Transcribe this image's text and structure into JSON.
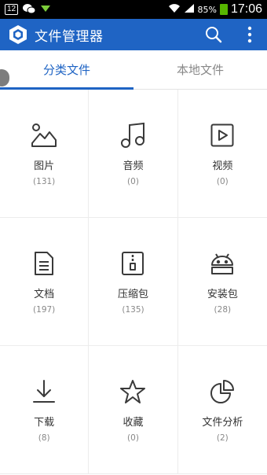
{
  "status_bar": {
    "notification_badge": "12",
    "battery": "85%",
    "time": "17:06"
  },
  "app_bar": {
    "title": "文件管理器"
  },
  "tabs": [
    {
      "label": "分类文件",
      "active": true
    },
    {
      "label": "本地文件",
      "active": false
    }
  ],
  "categories": [
    {
      "label": "图片",
      "count": "(131)",
      "icon": "image-icon"
    },
    {
      "label": "音频",
      "count": "(0)",
      "icon": "music-note-icon"
    },
    {
      "label": "视频",
      "count": "(0)",
      "icon": "video-play-icon"
    },
    {
      "label": "文档",
      "count": "(197)",
      "icon": "document-icon"
    },
    {
      "label": "压缩包",
      "count": "(135)",
      "icon": "archive-icon"
    },
    {
      "label": "安装包",
      "count": "(28)",
      "icon": "android-icon"
    },
    {
      "label": "下载",
      "count": "(8)",
      "icon": "download-icon"
    },
    {
      "label": "收藏",
      "count": "(0)",
      "icon": "star-icon"
    },
    {
      "label": "文件分析",
      "count": "(2)",
      "icon": "pie-chart-icon"
    }
  ],
  "colors": {
    "accent": "#1f64c4",
    "icon": "#3a3a3a"
  }
}
